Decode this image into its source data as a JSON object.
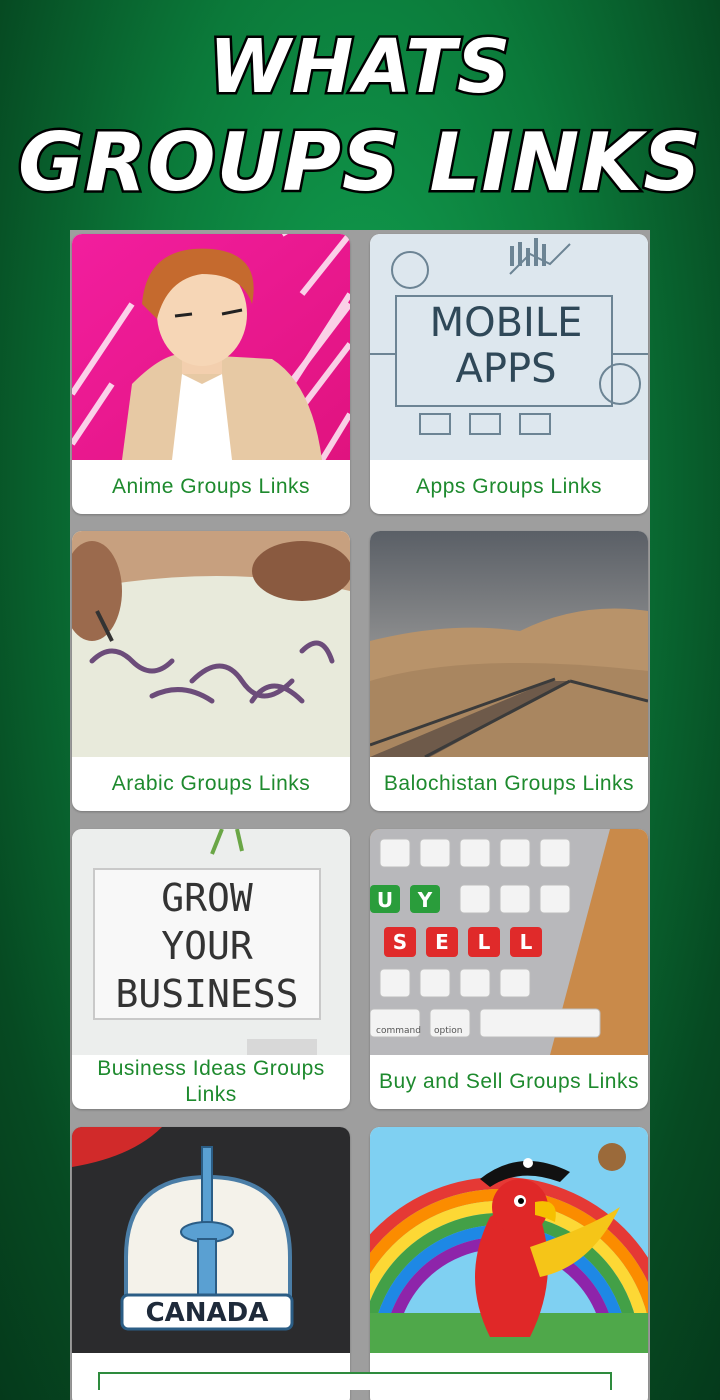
{
  "header": {
    "line1": "WHATS",
    "line2": "GROUPS LINKS"
  },
  "cards": [
    {
      "label": "Anime Groups Links",
      "icon": "anime-character-image"
    },
    {
      "label": "Apps Groups Links",
      "icon": "mobile-apps-image",
      "image_text": "MOBILE APPS"
    },
    {
      "label": "Arabic Groups Links",
      "icon": "arabic-calligraphy-image"
    },
    {
      "label": "Balochistan Groups Links",
      "icon": "desert-railway-image"
    },
    {
      "label": "Business Ideas Groups Links",
      "icon": "grow-business-image",
      "image_text": [
        "GROW",
        "YOUR",
        "BUSINESS"
      ]
    },
    {
      "label": "Buy and Sell Groups Links",
      "icon": "buy-sell-keyboard-image",
      "image_text": [
        "U",
        "Y",
        "S",
        "E",
        "L",
        "L",
        "command",
        "option"
      ]
    },
    {
      "label": "",
      "icon": "canada-tower-image",
      "image_text": "CANADA"
    },
    {
      "label": "",
      "icon": "parrot-rainbow-image"
    }
  ],
  "colors": {
    "accent": "#1e8a2e",
    "background": "#0b7a3a",
    "grid_bg": "#9e9e9e"
  }
}
